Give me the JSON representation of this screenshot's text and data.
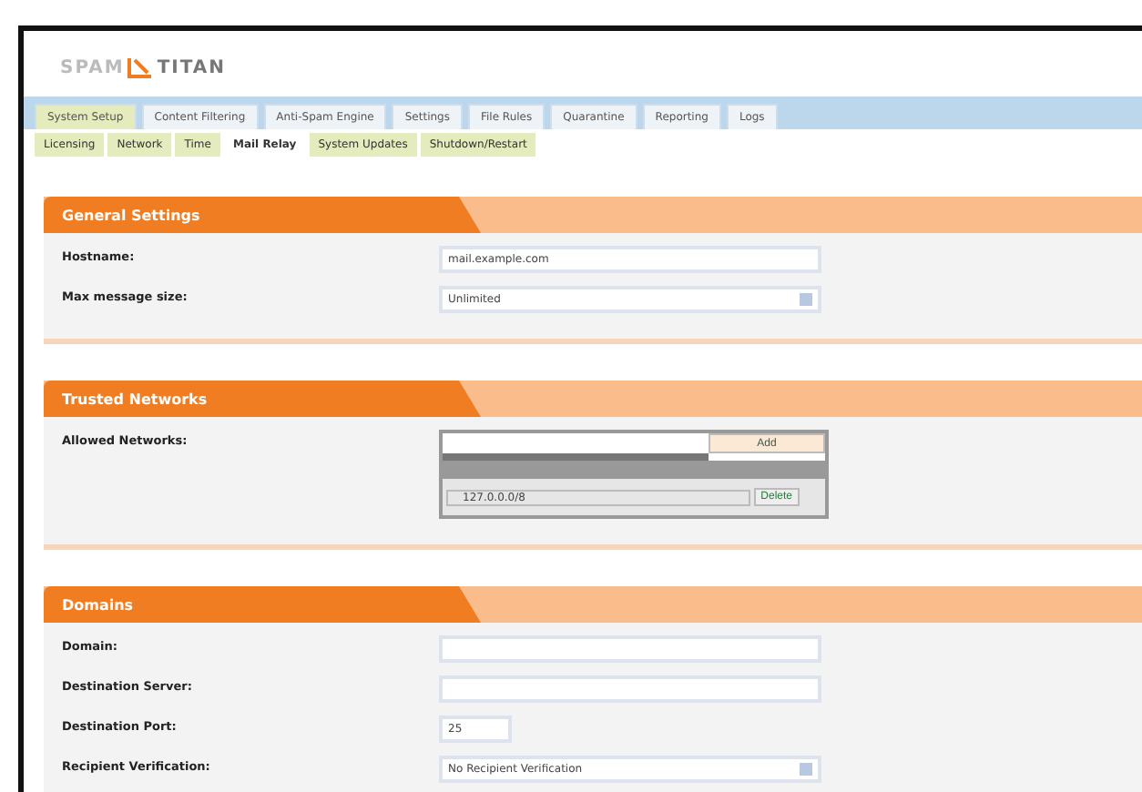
{
  "logo": {
    "left": "SPAM",
    "right": "TITAN"
  },
  "tabs": [
    {
      "label": "System Setup",
      "selected": true
    },
    {
      "label": "Content Filtering",
      "selected": false
    },
    {
      "label": "Anti-Spam Engine",
      "selected": false
    },
    {
      "label": "Settings",
      "selected": false
    },
    {
      "label": "File Rules",
      "selected": false
    },
    {
      "label": "Quarantine",
      "selected": false
    },
    {
      "label": "Reporting",
      "selected": false
    },
    {
      "label": "Logs",
      "selected": false
    }
  ],
  "subtabs": [
    {
      "label": "Licensing",
      "selected": false
    },
    {
      "label": "Network",
      "selected": false
    },
    {
      "label": "Time",
      "selected": false
    },
    {
      "label": "Mail Relay",
      "selected": true
    },
    {
      "label": "System Updates",
      "selected": false
    },
    {
      "label": "Shutdown/Restart",
      "selected": false
    }
  ],
  "sections": [
    {
      "title": "General Settings",
      "rows": [
        {
          "kind": "text",
          "label": "Hostname:",
          "value": "mail.example.com"
        },
        {
          "kind": "select",
          "label": "Max message size:",
          "value": "Unlimited"
        }
      ]
    },
    {
      "title": "Trusted Networks",
      "rows": [
        {
          "kind": "networks",
          "label": "Allowed Networks:",
          "button": "Add",
          "entries": [
            {
              "value": "127.0.0.0/8",
              "button": "Delete"
            }
          ]
        }
      ]
    },
    {
      "title": "Domains",
      "rows": [
        {
          "kind": "text",
          "label": "Domain:"
        },
        {
          "kind": "text",
          "label": "Destination Server:"
        },
        {
          "kind": "short",
          "label": "Destination Port:",
          "value": "25"
        },
        {
          "kind": "select",
          "label": "Recipient Verification:",
          "value": "No Recipient Verification"
        }
      ]
    }
  ]
}
